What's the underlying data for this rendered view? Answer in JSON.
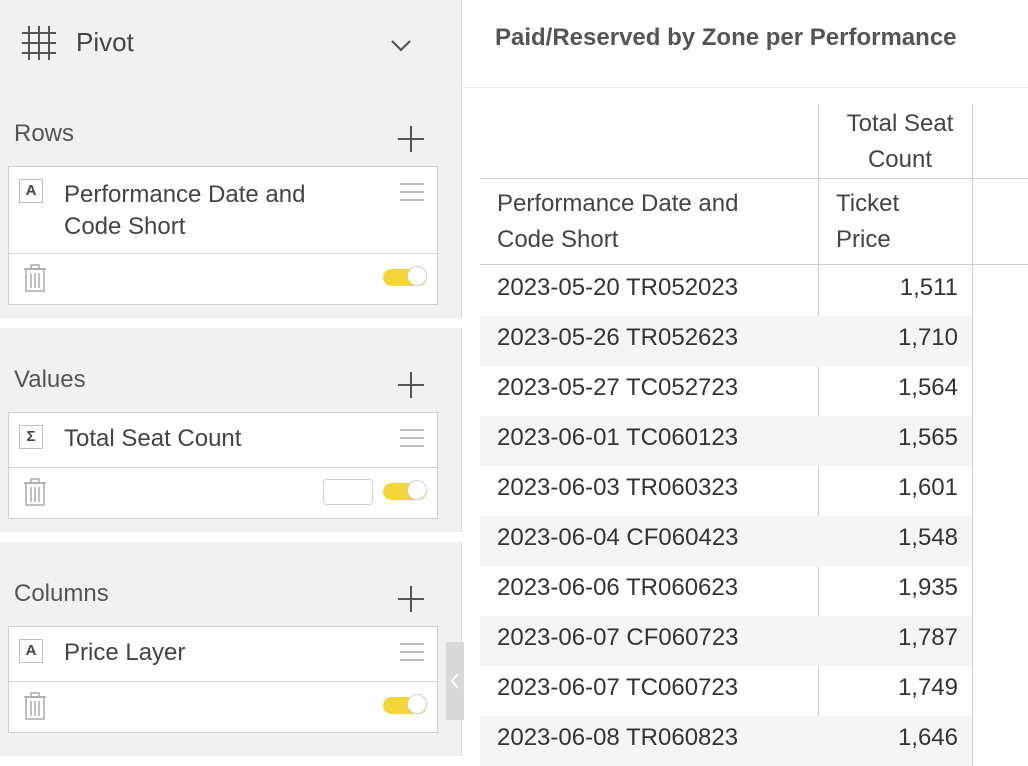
{
  "panel": {
    "title": "Pivot",
    "sections": {
      "rows": {
        "title": "Rows",
        "field": {
          "type_badge": "A",
          "name": "Performance Date and Code Short"
        }
      },
      "values": {
        "title": "Values",
        "field": {
          "type_badge": "Σ",
          "name": "Total Seat Count"
        }
      },
      "columns": {
        "title": "Columns",
        "field": {
          "type_badge": "A",
          "name": "Price Layer"
        }
      }
    },
    "icons": [
      "grid-icon",
      "chevron-down-icon",
      "plus-icon",
      "drag-handle-icon",
      "trash-icon",
      "chevron-left-icon"
    ],
    "accent_color": "#f5d63a"
  },
  "report": {
    "title": "Paid/Reserved by Zone per Performance",
    "table": {
      "column_header_top": "Total Seat Count",
      "row_header": "Performance Date and Code Short",
      "column_header_sub": "Ticket Price",
      "rows": [
        {
          "label": "2023-05-20 TR052023",
          "value": "1,511"
        },
        {
          "label": "2023-05-26 TR052623",
          "value": "1,710"
        },
        {
          "label": "2023-05-27 TC052723",
          "value": "1,564"
        },
        {
          "label": "2023-06-01 TC060123",
          "value": "1,565"
        },
        {
          "label": "2023-06-03 TR060323",
          "value": "1,601"
        },
        {
          "label": "2023-06-04 CF060423",
          "value": "1,548"
        },
        {
          "label": "2023-06-06 TR060623",
          "value": "1,935"
        },
        {
          "label": "2023-06-07 CF060723",
          "value": "1,787"
        },
        {
          "label": "2023-06-07 TC060723",
          "value": "1,749"
        },
        {
          "label": "2023-06-08 TR060823",
          "value": "1,646"
        }
      ]
    }
  }
}
